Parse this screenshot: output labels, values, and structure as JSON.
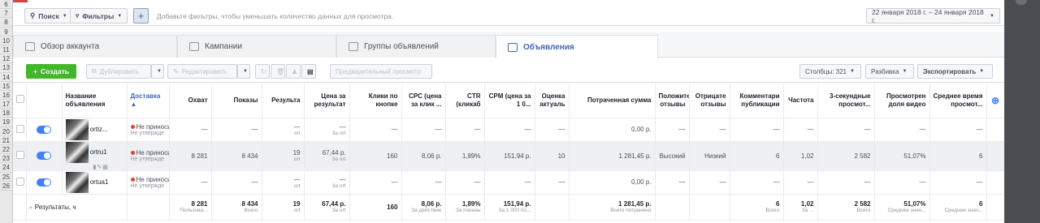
{
  "filterbar": {
    "search_label": "Поиск",
    "filters_label": "Фильтры",
    "hint": "Добавьте фильтры, чтобы уменьшать количество данных для просмотра.",
    "date_range": "22 января 2018 г. – 24 января 2018 г."
  },
  "tabs": [
    {
      "label": "Обзор аккаунта",
      "icon": "account-overview-icon"
    },
    {
      "label": "Кампании",
      "icon": "campaign-folder-icon"
    },
    {
      "label": "Группы объявлений",
      "icon": "adsets-grid-icon"
    },
    {
      "label": "Объявления",
      "icon": "ad-icon"
    }
  ],
  "toolbar": {
    "create_label": "Создать",
    "duplicate_label": "Дублировать",
    "edit_label": "Редактировать",
    "preview_label": "Предварительный просмотр",
    "columns_label": "Столбцы: 321",
    "breakdown_label": "Разбивка",
    "export_label": "Экспортировать"
  },
  "table": {
    "headers": [
      "Название объявления",
      "Доставка",
      "Охват",
      "Показы",
      "Результа",
      "Цена за результат",
      "Клики по кнопке",
      "CPC (цена за клик ...",
      "CTR (кликаб",
      "CPM (цена за 1 0...",
      "Оценка актуаль",
      "Потраченная сумма",
      "Положите отзывы",
      "Отрицате отзывы",
      "Комментари публикации",
      "Частота",
      "3-секундные просмот...",
      "Просмотрен доля видео",
      "Среднее время просмот..."
    ],
    "rows": [
      {
        "name": "ortiz...",
        "status": "Не приноси",
        "status_sub": "Не утвержде",
        "reach": "—",
        "impressions": "—",
        "results": "—",
        "results_sub": "ort",
        "cost": "—",
        "cost_sub": "За ort",
        "clicks": "—",
        "cpc": "—",
        "ctr": "—",
        "cpm": "—",
        "relevance": "—",
        "spent": "0,00 р.",
        "pos": "—",
        "neg": "—",
        "comments": "—",
        "freq": "—",
        "views3": "—",
        "watched": "—",
        "avgtime": "—"
      },
      {
        "name": "ortru1",
        "status": "Не приноси",
        "status_sub": "Не утвержде",
        "reach": "8 281",
        "impressions": "8 434",
        "results": "19",
        "results_sub": "ort",
        "cost": "67,44 р.",
        "cost_sub": "За ort",
        "clicks": "160",
        "cpc": "8,06 р.",
        "ctr": "1,89%",
        "cpm": "151,94 р.",
        "relevance": "10",
        "spent": "1 281,45 р.",
        "pos": "Высокий",
        "neg": "Низкий",
        "comments": "6",
        "freq": "1,02",
        "views3": "2 582",
        "watched": "51,07%",
        "avgtime": "6"
      },
      {
        "name": "ortua1",
        "status": "Не приноси",
        "status_sub": "Не утвержде",
        "reach": "—",
        "impressions": "—",
        "results": "—",
        "results_sub": "ort",
        "cost": "—",
        "cost_sub": "За ort",
        "clicks": "—",
        "cpc": "—",
        "ctr": "—",
        "cpm": "—",
        "relevance": "—",
        "spent": "0,00 р.",
        "pos": "—",
        "neg": "—",
        "comments": "—",
        "freq": "—",
        "views3": "—",
        "watched": "—",
        "avgtime": "—"
      }
    ],
    "total": {
      "label": "Результаты, ч",
      "reach": "8 281",
      "reach_sub": "Пользова...",
      "impressions": "8 434",
      "impressions_sub": "Всего",
      "results": "19",
      "results_sub": "ort",
      "cost": "67,44 р.",
      "cost_sub": "За ort",
      "clicks": "160",
      "cpc": "8,06 р.",
      "cpc_sub": "За действие",
      "ctr": "1,89%",
      "ctr_sub": "За показы",
      "cpm": "151,94 р.",
      "cpm_sub": "За 1 000 по...",
      "spent": "1 281,45 р.",
      "spent_sub": "Всего потрачено",
      "comments": "6",
      "comments_sub": "Всего",
      "freq": "1,02",
      "freq_sub": "За ...",
      "views3": "2 582",
      "views3_sub": "Всего",
      "watched": "51,07%",
      "watched_sub": "Среднее знач...",
      "avgtime": "6",
      "avgtime_sub": "Среднее знач..."
    }
  },
  "row_numbers": [
    "6",
    "7",
    "8",
    "9",
    "10",
    "11",
    "12",
    "13",
    "14",
    "15",
    "16",
    "17",
    "18",
    "19",
    "20",
    "21",
    "22",
    "23",
    "24",
    "25",
    "26"
  ]
}
